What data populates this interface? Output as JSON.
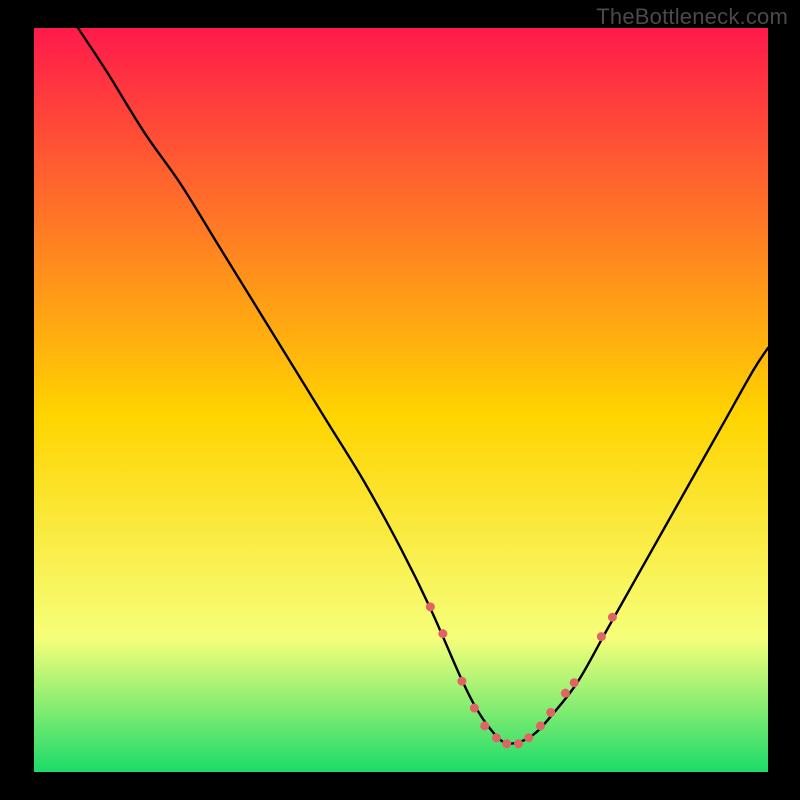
{
  "watermark": "TheBottleneck.com",
  "chart_data": {
    "type": "line",
    "title": "",
    "xlabel": "",
    "ylabel": "",
    "xlim": [
      0,
      100
    ],
    "ylim": [
      0,
      100
    ],
    "grid": false,
    "legend": false,
    "annotations": [],
    "background_gradient": {
      "top_color": "#ff1a4b",
      "mid_color": "#ffd400",
      "lower_color": "#f6ff7a",
      "bottom_color": "#1bdb6a"
    },
    "series": [
      {
        "name": "bottleneck-curve",
        "color": "#000000",
        "x": [
          6,
          10,
          15,
          20,
          25,
          30,
          35,
          40,
          45,
          50,
          54,
          58,
          60,
          62,
          64,
          66,
          68,
          70,
          74,
          78,
          82,
          86,
          90,
          94,
          98,
          100
        ],
        "y": [
          100,
          94,
          86,
          79,
          71,
          63,
          55,
          47,
          39,
          30,
          22,
          13,
          9,
          6,
          4,
          4,
          5,
          7,
          12,
          19,
          26,
          33,
          40,
          47,
          54,
          57
        ]
      }
    ],
    "markers": {
      "name": "highlight-points",
      "color": "#e06464",
      "radius": 4.5,
      "x": [
        54,
        55.7,
        58.3,
        60,
        61.4,
        63,
        64.4,
        66,
        67.4,
        69,
        70.4,
        72.4,
        73.6,
        77.3,
        78.8
      ],
      "y": [
        22.2,
        18.6,
        12.2,
        8.6,
        6.2,
        4.6,
        3.8,
        3.8,
        4.6,
        6.2,
        8,
        10.6,
        12,
        18.2,
        20.8
      ]
    }
  }
}
